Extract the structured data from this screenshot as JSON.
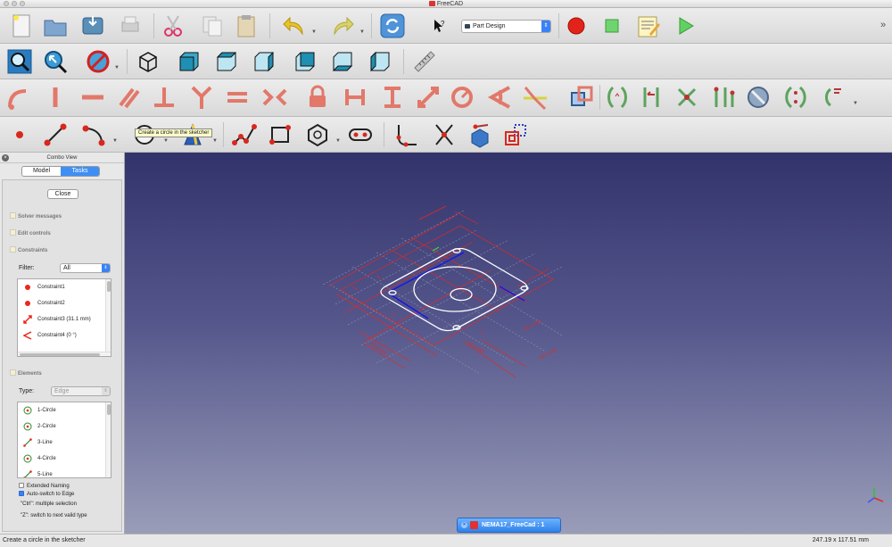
{
  "window": {
    "title": "FreeCAD"
  },
  "toolbar": {
    "workbench": "Part Design",
    "tooltip": "Create a circle in the sketcher"
  },
  "combo": {
    "title": "Combo View",
    "tabs": [
      {
        "label": "Model"
      },
      {
        "label": "Tasks"
      }
    ],
    "close_label": "Close",
    "sections": [
      "Solver messages",
      "Edit controls",
      "Constraints",
      "Elements"
    ],
    "filter_label": "Filter:",
    "filter_value": "All",
    "constraints": [
      {
        "label": "Constraint1",
        "icon": "coincident-icon"
      },
      {
        "label": "Constraint2",
        "icon": "coincident-icon"
      },
      {
        "label": "Constraint3 (31.1 mm)",
        "icon": "distance-icon"
      },
      {
        "label": "Constraint4 (0 °)",
        "icon": "angle-icon"
      }
    ],
    "type_label": "Type:",
    "type_value": "Edge",
    "elements": [
      {
        "label": "1-Circle",
        "icon": "circle-icon"
      },
      {
        "label": "2-Circle",
        "icon": "circle-icon"
      },
      {
        "label": "3-Line",
        "icon": "line-icon"
      },
      {
        "label": "4-Circle",
        "icon": "circle-icon"
      },
      {
        "label": "5-Line",
        "icon": "line-icon"
      }
    ],
    "extended_naming": "Extended Naming",
    "auto_switch": "Auto-switch to Edge",
    "hint_ctrl": "\"Ctrl\": multiple selection",
    "hint_z": "\"Z\": switch to next valid type"
  },
  "viewport": {
    "doc_tab": "NEMA17_FreeCad : 1",
    "dimensions": [
      "31.1 mm",
      "31.1 mm",
      "42.3 mm",
      "42.3 mm"
    ]
  },
  "status": {
    "message": "Create a circle in the sketcher",
    "coords": "247.19 x 117.51 mm"
  },
  "colors": {
    "accent": "#3d8ff5",
    "constraint": "#e8281e",
    "sketch_line": "#ffffff",
    "construction": "#2a2ad8"
  }
}
